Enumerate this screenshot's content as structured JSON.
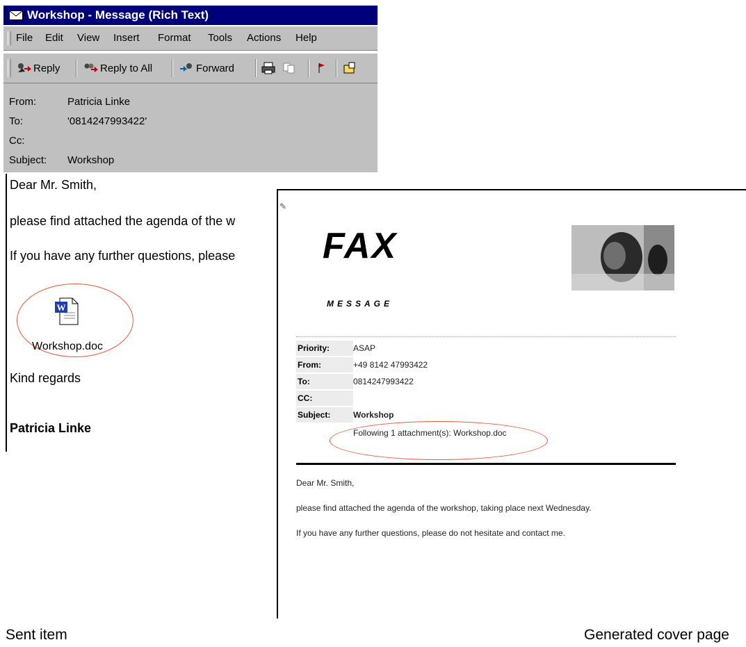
{
  "window": {
    "title": "Workshop - Message (Rich Text)",
    "icon": "envelope-icon"
  },
  "menu": [
    "File",
    "Edit",
    "View",
    "Insert",
    "Format",
    "Tools",
    "Actions",
    "Help"
  ],
  "toolbar": {
    "reply": "Reply",
    "reply_all": "Reply to All",
    "forward": "Forward",
    "icons": [
      "reply-icon",
      "reply-all-icon",
      "forward-icon",
      "print-icon",
      "copy-icon",
      "flag-icon",
      "move-to-folder-icon"
    ]
  },
  "header": {
    "from_label": "From:",
    "from_value": "Patricia Linke",
    "to_label": "To:",
    "to_value": "'0814247993422'",
    "cc_label": "Cc:",
    "cc_value": "",
    "subject_label": "Subject:",
    "subject_value": "Workshop"
  },
  "body": {
    "greeting": "Dear Mr. Smith,",
    "line1": "please find attached the agenda of the w",
    "line2": "If you have any further questions, please",
    "attachment_name": "Workshop.doc",
    "closing": "Kind regards",
    "signature": "Patricia Linke"
  },
  "cover": {
    "title": "FAX",
    "subtitle": "MESSAGE",
    "fields": {
      "priority_label": "Priority:",
      "priority_value": "ASAP",
      "from_label": "From:",
      "from_value": "+49 8142 47993422",
      "to_label": "To:",
      "to_value": "0814247993422",
      "cc_label": "CC:",
      "cc_value": "",
      "subject_label": "Subject:",
      "subject_value": "Workshop"
    },
    "attachment_note": "Following 1 attachment(s): Workshop.doc",
    "greeting": "Dear Mr. Smith,",
    "line1": "please find attached the agenda of the workshop, taking place next Wednesday.",
    "line2": "If you have any further questions, please do not hesitate and contact me."
  },
  "captions": {
    "left": "Sent item",
    "right": "Generated cover page"
  },
  "colors": {
    "titlebar": "#00007b",
    "chrome": "#c0c0c0",
    "highlight_ring": "#e8573b"
  }
}
